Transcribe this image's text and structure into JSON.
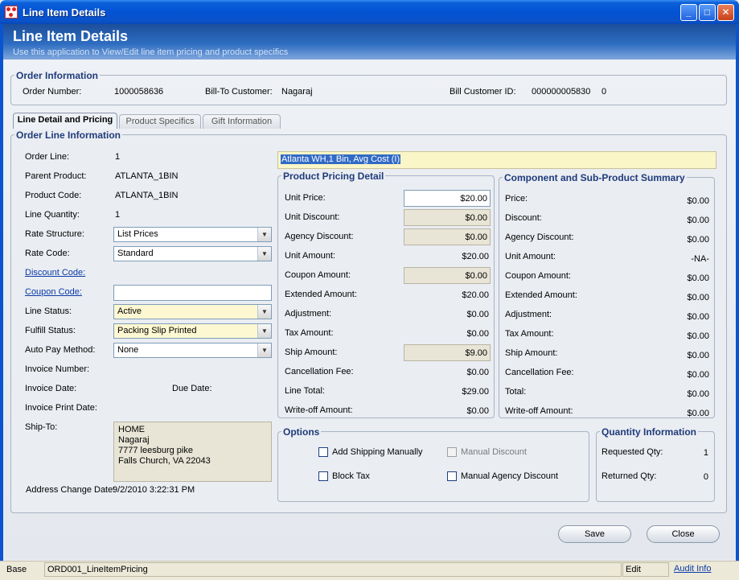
{
  "window": {
    "title": "Line Item Details",
    "min_glyph": "_",
    "max_glyph": "□",
    "close_glyph": "✕"
  },
  "header": {
    "title": "Line Item Details",
    "subtitle": "Use this application to View/Edit line item pricing and product specifics"
  },
  "order_info": {
    "legend": "Order Information",
    "order_number_label": "Order Number:",
    "order_number": "1000058636",
    "bill_to_label": "Bill-To Customer:",
    "bill_to": "Nagaraj",
    "bill_id_label": "Bill Customer ID:",
    "bill_id": "000000005830",
    "bill_id_suffix": "0"
  },
  "tabs": [
    {
      "label": "Line Detail and Pricing"
    },
    {
      "label": "Product Specifics"
    },
    {
      "label": "Gift Information"
    }
  ],
  "order_line": {
    "legend": "Order Line Information",
    "order_line_label": "Order Line:",
    "order_line": "1",
    "parent_product_label": "Parent Product:",
    "parent_product": "ATLANTA_1BIN",
    "product_code_label": "Product Code:",
    "product_code": "ATLANTA_1BIN",
    "line_qty_label": "Line Quantity:",
    "line_qty": "1",
    "rate_structure_label": "Rate Structure:",
    "rate_structure": "List Prices",
    "rate_code_label": "Rate Code:",
    "rate_code": "Standard",
    "discount_code_label": "Discount Code:",
    "coupon_code_label": "Coupon Code:",
    "coupon_code": "",
    "line_status_label": "Line Status:",
    "line_status": "Active",
    "fulfill_status_label": "Fulfill Status:",
    "fulfill_status": "Packing Slip Printed",
    "auto_pay_label": "Auto Pay Method:",
    "auto_pay": "None",
    "invoice_number_label": "Invoice Number:",
    "invoice_date_label": "Invoice Date:",
    "due_date_label": "Due Date:",
    "invoice_print_label": "Invoice Print Date:",
    "ship_to_label": "Ship-To:",
    "ship_to_lines": [
      "HOME",
      "Nagaraj",
      "7777 leesburg pike",
      "Falls Church, VA 22043"
    ],
    "address_change_label": "Address Change Date:",
    "address_change": "9/2/2010 3:22:31 PM"
  },
  "product_desc": "Atlanta WH,1 Bin, Avg Cost (I)",
  "pricing": {
    "legend": "Product Pricing Detail",
    "rows": [
      {
        "label": "Unit Price:",
        "value": "$20.00",
        "box": "white"
      },
      {
        "label": "Unit Discount:",
        "value": "$0.00",
        "box": "grey"
      },
      {
        "label": "Agency Discount:",
        "value": "$0.00",
        "box": "grey"
      },
      {
        "label": "Unit Amount:",
        "value": "$20.00",
        "box": "none"
      },
      {
        "label": "Coupon Amount:",
        "value": "$0.00",
        "box": "grey"
      },
      {
        "label": "Extended Amount:",
        "value": "$20.00",
        "box": "none"
      },
      {
        "label": "Adjustment:",
        "value": "$0.00",
        "box": "none"
      },
      {
        "label": "Tax Amount:",
        "value": "$0.00",
        "box": "none"
      },
      {
        "label": "Ship Amount:",
        "value": "$9.00",
        "box": "grey"
      },
      {
        "label": "Cancellation Fee:",
        "value": "$0.00",
        "box": "none"
      },
      {
        "label": "Line Total:",
        "value": "$29.00",
        "box": "none"
      },
      {
        "label": "Write-off Amount:",
        "value": "$0.00",
        "box": "none"
      }
    ]
  },
  "summary": {
    "legend": "Component and Sub-Product Summary",
    "rows": [
      {
        "label": "Price:",
        "value": "$0.00"
      },
      {
        "label": "Discount:",
        "value": "$0.00"
      },
      {
        "label": "Agency Discount:",
        "value": "$0.00"
      },
      {
        "label": "Unit Amount:",
        "value": "-NA-"
      },
      {
        "label": "Coupon Amount:",
        "value": "$0.00"
      },
      {
        "label": "Extended Amount:",
        "value": "$0.00"
      },
      {
        "label": "Adjustment:",
        "value": "$0.00"
      },
      {
        "label": "Tax Amount:",
        "value": "$0.00"
      },
      {
        "label": "Ship Amount:",
        "value": "$0.00"
      },
      {
        "label": "Cancellation Fee:",
        "value": "$0.00"
      },
      {
        "label": "Total:",
        "value": "$0.00"
      },
      {
        "label": "Write-off Amount:",
        "value": "$0.00"
      }
    ]
  },
  "options": {
    "legend": "Options",
    "add_shipping": "Add Shipping Manually",
    "block_tax": "Block Tax",
    "manual_discount": "Manual Discount",
    "manual_agency": "Manual Agency Discount"
  },
  "quantity": {
    "legend": "Quantity Information",
    "requested_label": "Requested Qty:",
    "requested": "1",
    "returned_label": "Returned Qty:",
    "returned": "0"
  },
  "buttons": {
    "save": "Save",
    "close": "Close"
  },
  "status": {
    "base": "Base",
    "form_id": "ORD001_LineItemPricing",
    "mode": "Edit",
    "audit": "Audit Info"
  },
  "colors": {
    "accent": "#1f3b7a",
    "title_bar": "#0453d4",
    "highlight_field": "#fdf8d2",
    "selected_text": "#316ac5"
  }
}
